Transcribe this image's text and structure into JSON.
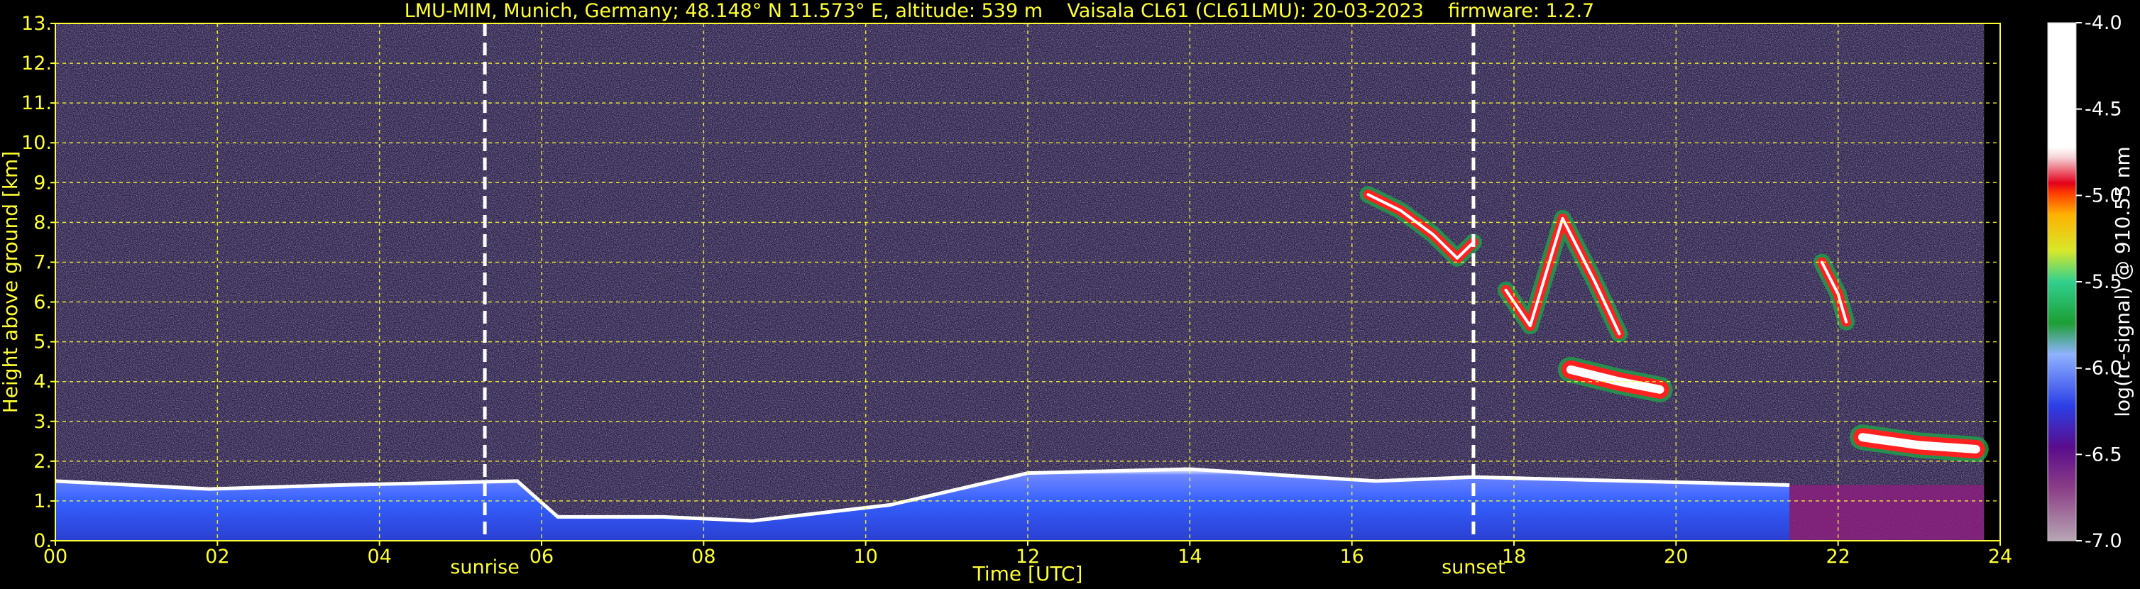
{
  "chart_data": {
    "type": "heatmap",
    "title": "LMU-MIM, Munich, Germany; 48.148° N 11.573° E, altitude: 539 m    Vaisala CL61 (CL61LMU): 20-03-2023    firmware: 1.2.7",
    "xlabel": "Time [UTC]",
    "ylabel": "Height above ground [km]",
    "xlim": [
      0,
      24
    ],
    "ylim": [
      0,
      13
    ],
    "x_ticks": [
      "00",
      "02",
      "04",
      "06",
      "08",
      "10",
      "12",
      "14",
      "16",
      "18",
      "20",
      "22",
      "24"
    ],
    "y_ticks": [
      "0.",
      "1.",
      "2.",
      "3.",
      "4.",
      "5.",
      "6.",
      "7.",
      "8.",
      "9.",
      "10.",
      "11.",
      "12.",
      "13."
    ],
    "grid": true,
    "colorbar": {
      "label": "log(rc-signal) @ 910.55 nm",
      "ticks": [
        "-4.0",
        "-4.5",
        "-5.0",
        "-5.5",
        "-6.0",
        "-6.5",
        "-7.0"
      ],
      "range": [
        -7.0,
        -4.0
      ]
    },
    "annotations": [
      {
        "text": "sunrise",
        "x": 5.3
      },
      {
        "text": "sunset",
        "x": 17.5
      }
    ],
    "data_end_time": 23.8,
    "features": [
      {
        "kind": "boundary_layer_top",
        "points": [
          [
            0,
            1.5
          ],
          [
            1.9,
            1.3
          ],
          [
            3.5,
            1.4
          ],
          [
            5.7,
            1.5
          ],
          [
            6.2,
            0.6
          ],
          [
            7.5,
            0.6
          ],
          [
            8.6,
            0.5
          ],
          [
            10.3,
            0.9
          ],
          [
            12,
            1.7
          ],
          [
            14,
            1.8
          ],
          [
            15.5,
            1.6
          ],
          [
            16.3,
            1.5
          ],
          [
            17.5,
            1.6
          ],
          [
            21.4,
            1.4
          ]
        ]
      },
      {
        "kind": "cirrus",
        "points": [
          [
            16.2,
            8.7
          ],
          [
            16.6,
            8.3
          ],
          [
            17.0,
            7.7
          ],
          [
            17.3,
            7.1
          ],
          [
            17.5,
            7.5
          ]
        ]
      },
      {
        "kind": "cirrus",
        "points": [
          [
            17.9,
            6.3
          ],
          [
            18.2,
            5.4
          ],
          [
            18.6,
            8.1
          ],
          [
            19.0,
            6.5
          ],
          [
            19.3,
            5.2
          ]
        ]
      },
      {
        "kind": "cloud_layer",
        "points": [
          [
            18.7,
            4.3
          ],
          [
            19.3,
            4.0
          ],
          [
            19.8,
            3.8
          ]
        ]
      },
      {
        "kind": "cirrus",
        "points": [
          [
            21.8,
            7.0
          ],
          [
            22.0,
            6.2
          ],
          [
            22.1,
            5.5
          ]
        ]
      },
      {
        "kind": "cloud_layer",
        "points": [
          [
            22.3,
            2.6
          ],
          [
            23.0,
            2.4
          ],
          [
            23.7,
            2.3
          ]
        ]
      }
    ]
  }
}
